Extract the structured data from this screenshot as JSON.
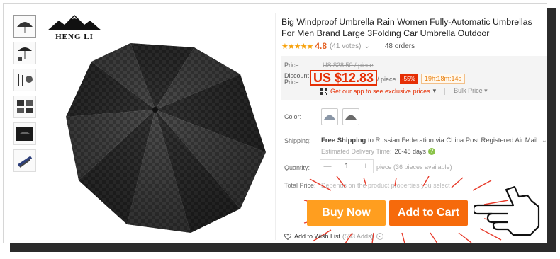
{
  "brand": {
    "name": "HENG LI"
  },
  "product": {
    "title": "Big Windproof Umbrella Rain Women Fully-Automatic Umbrellas For Men Brand Large 3Folding Car Umbrella Outdoor",
    "stars": "★★★★★",
    "rating": "4.8",
    "votes": "(41 votes)",
    "votes_chevron": "⌄",
    "orders": "48 orders"
  },
  "price": {
    "label": "Price:",
    "original": "US $28.50 / piece",
    "discount_label": "Discount Price:",
    "discount": "US $12.83",
    "per_unit": "/ piece",
    "off_badge": "-55%",
    "timer": "19h:18m:14s",
    "app_offer": "Get our app to see exclusive prices",
    "app_chevron": "▾",
    "bulk_price": "Bulk Price ▾"
  },
  "options": {
    "color_label": "Color:",
    "shipping_label": "Shipping:",
    "shipping_free": "Free Shipping",
    "shipping_rest": "to Russian Federation via China Post Registered Air Mail",
    "shipping_chevron": "⌄",
    "eta_label": "Estimated Delivery Time:",
    "eta_days": "26-48 days",
    "eta_help": "?",
    "quantity_label": "Quantity:",
    "qty_minus": "—",
    "qty_value": "1",
    "qty_plus": "+",
    "qty_available": "piece (36 pieces available)",
    "total_label": "Total Price:",
    "total_text": "Depends on the product properties you select"
  },
  "actions": {
    "buy_now": "Buy Now",
    "add_to_cart": "Add to Cart",
    "wish_list": "Add to Wish List",
    "wish_count": "(553 Adds)",
    "wish_chevron": "⌄"
  },
  "colors": {
    "accent_red": "#e62e04",
    "buy_orange": "#ff9e1f",
    "cart_orange": "#f66a0b",
    "star_yellow": "#f7a10b"
  }
}
